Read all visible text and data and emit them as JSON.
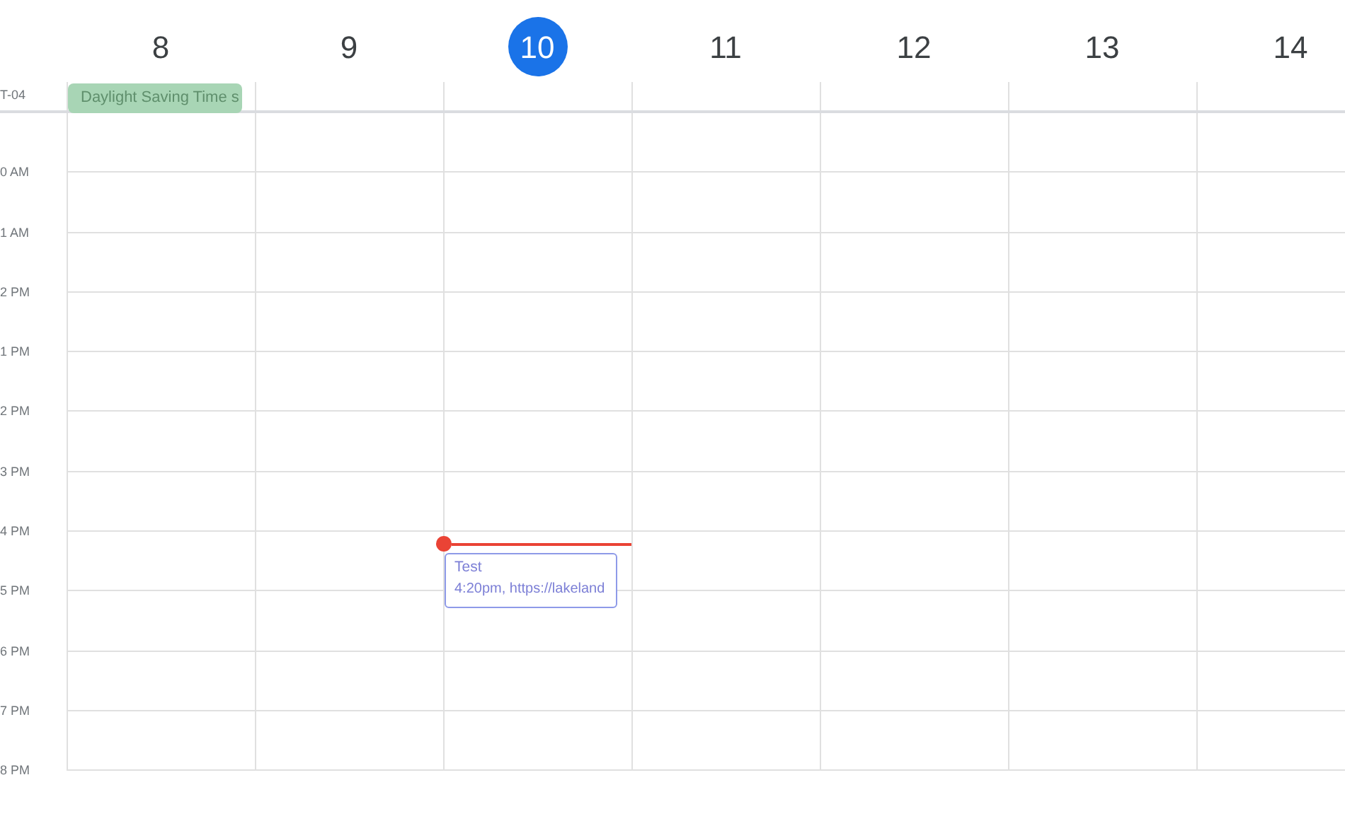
{
  "days": [
    {
      "number": "8",
      "selected": false,
      "current_time": false,
      "all_day_events": [
        {
          "title": "Daylight Saving Time s"
        }
      ]
    },
    {
      "number": "9",
      "selected": false,
      "current_time": false
    },
    {
      "number": "10",
      "selected": true,
      "current_time": true,
      "events": [
        {
          "title": "Test",
          "details": "4:20pm, https://lakeland"
        }
      ]
    },
    {
      "number": "11",
      "selected": false,
      "current_time": false
    },
    {
      "number": "12",
      "selected": false,
      "current_time": false
    },
    {
      "number": "13",
      "selected": false,
      "current_time": false
    },
    {
      "number": "14",
      "selected": false,
      "current_time": false
    }
  ],
  "timezone": "T-04",
  "hours": [
    "0 AM",
    "1 AM",
    "2 PM",
    "1 PM",
    "2 PM",
    "3 PM",
    "4 PM",
    "5 PM",
    "6 PM",
    "7 PM",
    "8 PM"
  ]
}
